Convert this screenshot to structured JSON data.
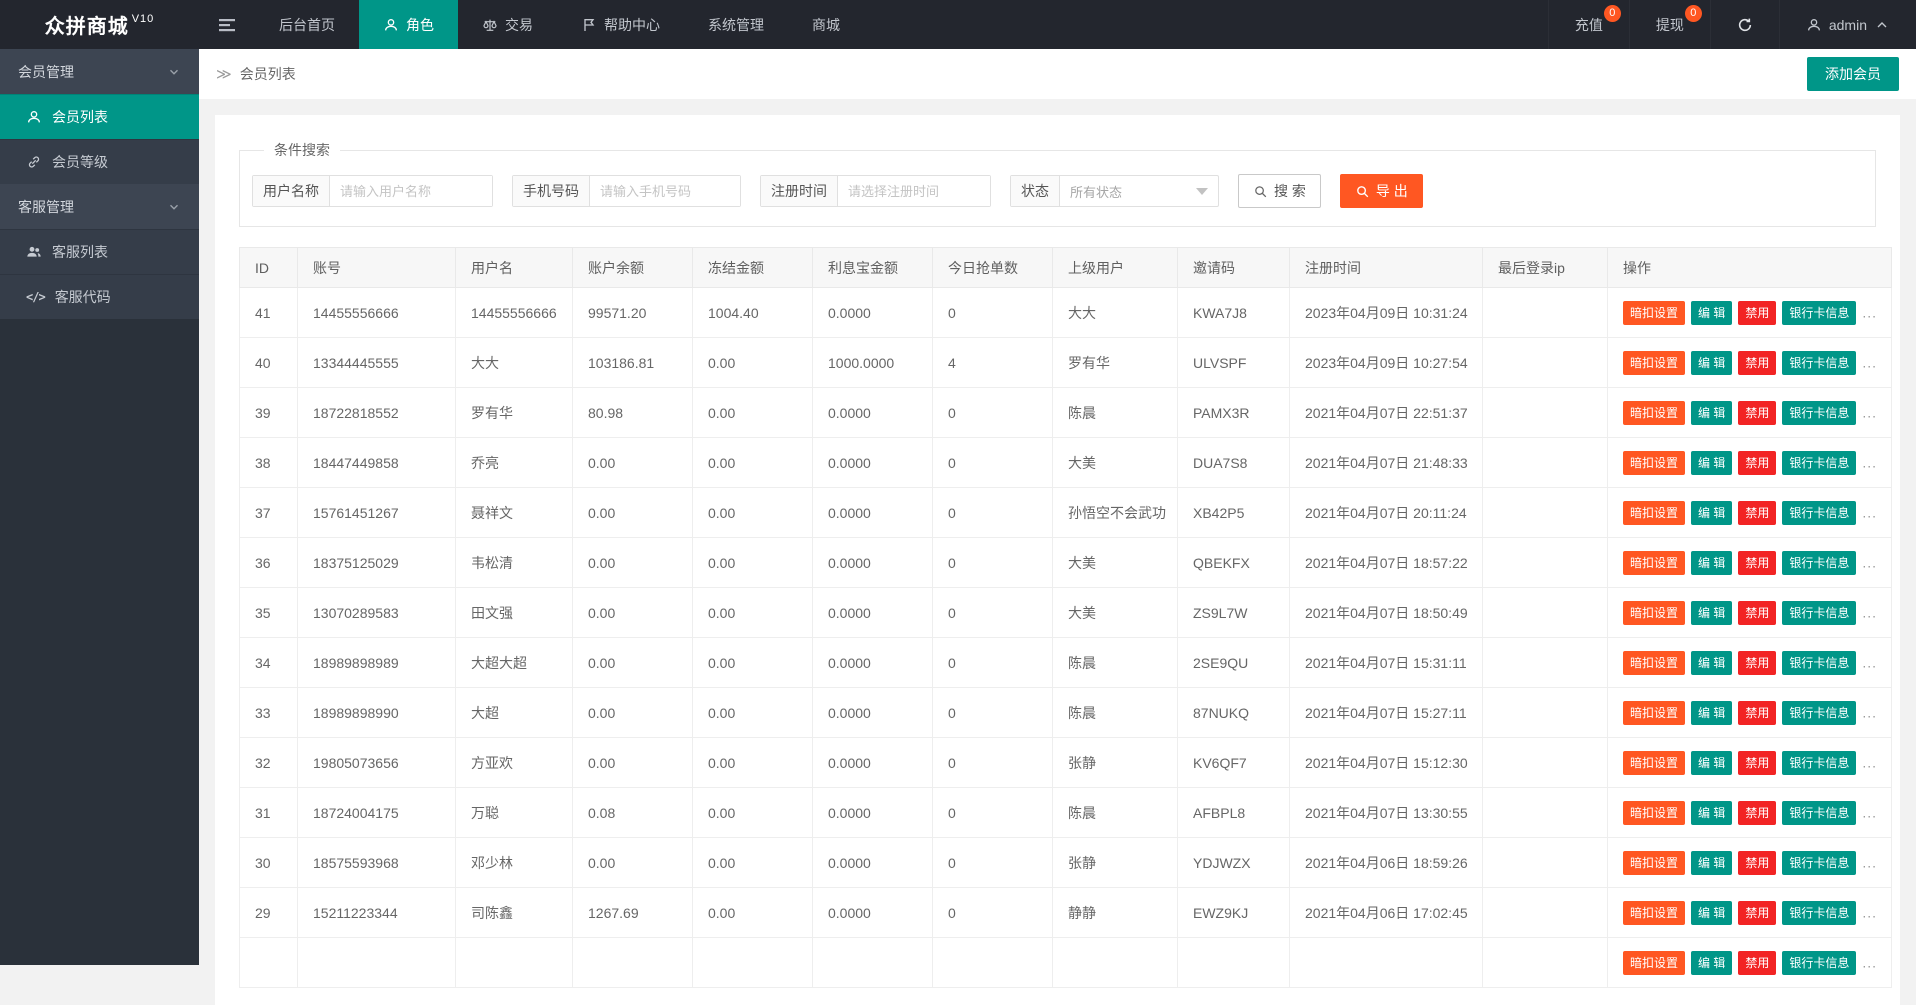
{
  "app": {
    "title": "众拼商城",
    "version": "V10"
  },
  "navbar": {
    "items": [
      {
        "label": "后台首页"
      },
      {
        "label": "角色",
        "icon": "person-icon",
        "active": true
      },
      {
        "label": "交易",
        "icon": "scales-icon"
      },
      {
        "label": "帮助中心",
        "icon": "flag-icon"
      },
      {
        "label": "系统管理"
      },
      {
        "label": "商城"
      }
    ],
    "recharge": {
      "label": "充值",
      "badge": "0"
    },
    "withdraw": {
      "label": "提现",
      "badge": "0"
    },
    "user": "admin"
  },
  "sidebar": {
    "groups": [
      {
        "label": "会员管理",
        "items": [
          {
            "label": "会员列表",
            "icon": "person-icon",
            "active": true
          },
          {
            "label": "会员等级",
            "icon": "link-icon"
          }
        ]
      },
      {
        "label": "客服管理",
        "items": [
          {
            "label": "客服列表",
            "icon": "users-icon"
          },
          {
            "label": "客服代码",
            "icon": "code-icon"
          }
        ]
      }
    ]
  },
  "breadcrumb": {
    "caret": "≫",
    "label": "会员列表"
  },
  "toolbar": {
    "add_member_label": "添加会员"
  },
  "search": {
    "legend": "条件搜索",
    "fields": [
      {
        "label": "用户名称",
        "placeholder": "请输入用户名称"
      },
      {
        "label": "手机号码",
        "placeholder": "请输入手机号码"
      },
      {
        "label": "注册时间",
        "placeholder": "请选择注册时间"
      },
      {
        "label": "状态",
        "value": "所有状态"
      }
    ],
    "search_button": "搜 索",
    "export_button": "导 出"
  },
  "table": {
    "headers": [
      "ID",
      "账号",
      "用户名",
      "账户余额",
      "冻结金额",
      "利息宝金额",
      "今日抢单数",
      "上级用户",
      "邀请码",
      "注册时间",
      "最后登录ip",
      "操作"
    ],
    "actions": [
      "暗扣设置",
      "编 辑",
      "禁用",
      "银行卡信息"
    ],
    "ellipsis": "...",
    "rows": [
      {
        "id": "41",
        "account": "14455556666",
        "username": "14455556666",
        "balance": "99571.20",
        "frozen": "1004.40",
        "interest": "0.0000",
        "today_orders": "0",
        "parent": "大大",
        "invite_code": "KWA7J8",
        "reg_time": "2023年04月09日 10:31:24",
        "last_ip": ""
      },
      {
        "id": "40",
        "account": "13344445555",
        "username": "大大",
        "balance": "103186.81",
        "frozen": "0.00",
        "interest": "1000.0000",
        "today_orders": "4",
        "parent": "罗有华",
        "invite_code": "ULVSPF",
        "reg_time": "2023年04月09日 10:27:54",
        "last_ip": ""
      },
      {
        "id": "39",
        "account": "18722818552",
        "username": "罗有华",
        "balance": "80.98",
        "frozen": "0.00",
        "interest": "0.0000",
        "today_orders": "0",
        "parent": "陈晨",
        "invite_code": "PAMX3R",
        "reg_time": "2021年04月07日 22:51:37",
        "last_ip": ""
      },
      {
        "id": "38",
        "account": "18447449858",
        "username": "乔亮",
        "balance": "0.00",
        "frozen": "0.00",
        "interest": "0.0000",
        "today_orders": "0",
        "parent": "大美",
        "invite_code": "DUA7S8",
        "reg_time": "2021年04月07日 21:48:33",
        "last_ip": ""
      },
      {
        "id": "37",
        "account": "15761451267",
        "username": "聂祥文",
        "balance": "0.00",
        "frozen": "0.00",
        "interest": "0.0000",
        "today_orders": "0",
        "parent": "孙悟空不会武功",
        "invite_code": "XB42P5",
        "reg_time": "2021年04月07日 20:11:24",
        "last_ip": ""
      },
      {
        "id": "36",
        "account": "18375125029",
        "username": "韦松清",
        "balance": "0.00",
        "frozen": "0.00",
        "interest": "0.0000",
        "today_orders": "0",
        "parent": "大美",
        "invite_code": "QBEKFX",
        "reg_time": "2021年04月07日 18:57:22",
        "last_ip": ""
      },
      {
        "id": "35",
        "account": "13070289583",
        "username": "田文强",
        "balance": "0.00",
        "frozen": "0.00",
        "interest": "0.0000",
        "today_orders": "0",
        "parent": "大美",
        "invite_code": "ZS9L7W",
        "reg_time": "2021年04月07日 18:50:49",
        "last_ip": ""
      },
      {
        "id": "34",
        "account": "18989898989",
        "username": "大超大超",
        "balance": "0.00",
        "frozen": "0.00",
        "interest": "0.0000",
        "today_orders": "0",
        "parent": "陈晨",
        "invite_code": "2SE9QU",
        "reg_time": "2021年04月07日 15:31:11",
        "last_ip": ""
      },
      {
        "id": "33",
        "account": "18989898990",
        "username": "大超",
        "balance": "0.00",
        "frozen": "0.00",
        "interest": "0.0000",
        "today_orders": "0",
        "parent": "陈晨",
        "invite_code": "87NUKQ",
        "reg_time": "2021年04月07日 15:27:11",
        "last_ip": ""
      },
      {
        "id": "32",
        "account": "19805073656",
        "username": "方亚欢",
        "balance": "0.00",
        "frozen": "0.00",
        "interest": "0.0000",
        "today_orders": "0",
        "parent": "张静",
        "invite_code": "KV6QF7",
        "reg_time": "2021年04月07日 15:12:30",
        "last_ip": ""
      },
      {
        "id": "31",
        "account": "18724004175",
        "username": "万聪",
        "balance": "0.08",
        "frozen": "0.00",
        "interest": "0.0000",
        "today_orders": "0",
        "parent": "陈晨",
        "invite_code": "AFBPL8",
        "reg_time": "2021年04月07日 13:30:55",
        "last_ip": ""
      },
      {
        "id": "30",
        "account": "18575593968",
        "username": "邓少林",
        "balance": "0.00",
        "frozen": "0.00",
        "interest": "0.0000",
        "today_orders": "0",
        "parent": "张静",
        "invite_code": "YDJWZX",
        "reg_time": "2021年04月06日 18:59:26",
        "last_ip": ""
      },
      {
        "id": "29",
        "account": "15211223344",
        "username": "司陈鑫",
        "balance": "1267.69",
        "frozen": "0.00",
        "interest": "0.0000",
        "today_orders": "0",
        "parent": "静静",
        "invite_code": "EWZ9KJ",
        "reg_time": "2021年04月06日 17:02:45",
        "last_ip": ""
      },
      {
        "partial": true,
        "id": "",
        "account": "",
        "username": "",
        "balance": "",
        "frozen": "",
        "interest": "",
        "today_orders": "",
        "parent": "",
        "invite_code": "",
        "reg_time": "",
        "last_ip": ""
      }
    ]
  },
  "colors": {
    "accent_teal": "#009688",
    "accent_orange": "#ff5722",
    "danger_red": "#f22424",
    "navbar_bg": "#23262e",
    "sidebar_bg": "#353d49"
  }
}
